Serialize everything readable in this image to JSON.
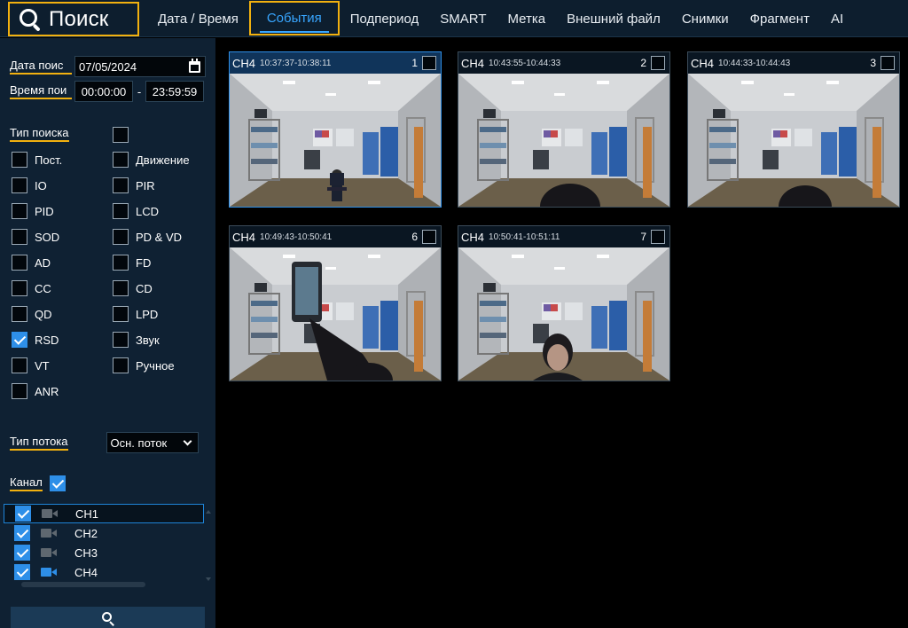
{
  "header": {
    "title": "Поиск",
    "tabs": [
      {
        "label": "Дата / Время"
      },
      {
        "label": "События"
      },
      {
        "label": "Подпериод"
      },
      {
        "label": "SMART"
      },
      {
        "label": "Метка"
      },
      {
        "label": "Внешний файл"
      },
      {
        "label": "Снимки"
      },
      {
        "label": "Фрагмент"
      },
      {
        "label": "AI"
      }
    ]
  },
  "sidebar": {
    "date_label": "Дата поис",
    "date_value": "07/05/2024",
    "time_label": "Время пои",
    "time_start": "00:00:00",
    "time_sep": "-",
    "time_end": "23:59:59",
    "search_type_label": "Тип поиска",
    "types": [
      {
        "label": "Пост.",
        "checked": false
      },
      {
        "label": "Движение",
        "checked": false
      },
      {
        "label": "IO",
        "checked": false
      },
      {
        "label": "PIR",
        "checked": false
      },
      {
        "label": "PID",
        "checked": false
      },
      {
        "label": "LCD",
        "checked": false
      },
      {
        "label": "SOD",
        "checked": false
      },
      {
        "label": "PD & VD",
        "checked": false
      },
      {
        "label": "AD",
        "checked": false
      },
      {
        "label": "FD",
        "checked": false
      },
      {
        "label": "CC",
        "checked": false
      },
      {
        "label": "CD",
        "checked": false
      },
      {
        "label": "QD",
        "checked": false
      },
      {
        "label": "LPD",
        "checked": false
      },
      {
        "label": "RSD",
        "checked": true
      },
      {
        "label": "Звук",
        "checked": false
      },
      {
        "label": "VT",
        "checked": false
      },
      {
        "label": "Ручное",
        "checked": false
      },
      {
        "label": "ANR",
        "checked": false
      }
    ],
    "stream_label": "Тип потока",
    "stream_value": "Осн. поток",
    "channel_label": "Канал",
    "channels": [
      {
        "label": "CH1",
        "checked": true,
        "active": false
      },
      {
        "label": "CH2",
        "checked": true,
        "active": false
      },
      {
        "label": "CH3",
        "checked": true,
        "active": false
      },
      {
        "label": "CH4",
        "checked": true,
        "active": true
      }
    ]
  },
  "results": [
    {
      "channel": "CH4",
      "time": "10:37:37-10:38:11",
      "num": "1"
    },
    {
      "channel": "CH4",
      "time": "10:43:55-10:44:33",
      "num": "2"
    },
    {
      "channel": "CH4",
      "time": "10:44:33-10:44:43",
      "num": "3"
    },
    {
      "channel": "CH4",
      "time": "10:49:43-10:50:41",
      "num": "6"
    },
    {
      "channel": "CH4",
      "time": "10:50:41-10:51:11",
      "num": "7"
    }
  ],
  "colors": {
    "accent": "#2e8fe8",
    "highlight": "#f2b10f",
    "panel": "#0f2133"
  }
}
